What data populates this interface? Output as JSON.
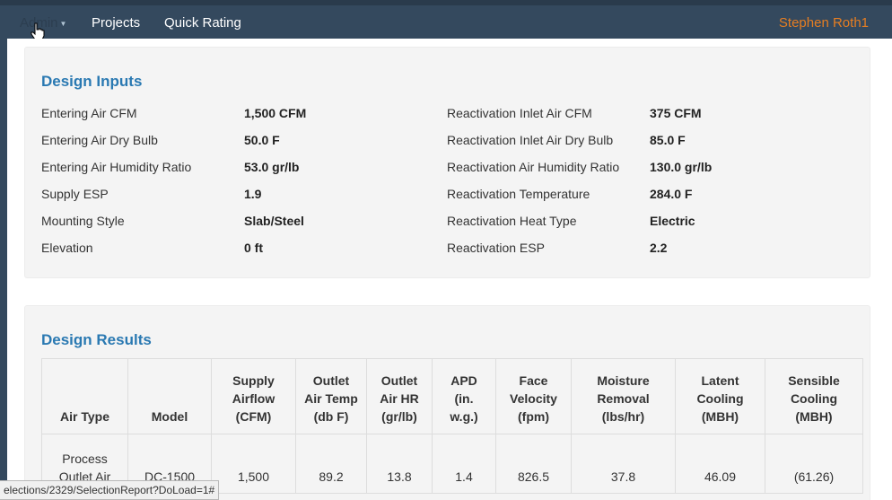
{
  "nav": {
    "admin": "Admin",
    "projects": "Projects",
    "quick_rating": "Quick Rating",
    "user": "Stephen Roth1"
  },
  "design_inputs": {
    "title": "Design Inputs",
    "left": [
      {
        "label": "Entering Air CFM",
        "value": "1,500 CFM"
      },
      {
        "label": "Entering Air Dry Bulb",
        "value": "50.0 F"
      },
      {
        "label": "Entering Air Humidity Ratio",
        "value": "53.0 gr/lb"
      },
      {
        "label": "Supply ESP",
        "value": "1.9"
      },
      {
        "label": "Mounting Style",
        "value": "Slab/Steel"
      },
      {
        "label": "Elevation",
        "value": "0 ft"
      }
    ],
    "right": [
      {
        "label": "Reactivation Inlet Air CFM",
        "value": "375 CFM"
      },
      {
        "label": "Reactivation Inlet Air Dry Bulb",
        "value": "85.0 F"
      },
      {
        "label": "Reactivation Air Humidity Ratio",
        "value": "130.0 gr/lb"
      },
      {
        "label": "Reactivation Temperature",
        "value": "284.0 F"
      },
      {
        "label": "Reactivation Heat Type",
        "value": "Electric"
      },
      {
        "label": "Reactivation ESP",
        "value": "2.2"
      }
    ]
  },
  "design_results": {
    "title": "Design Results",
    "headers": [
      [
        "Air Type"
      ],
      [
        "Model"
      ],
      [
        "Supply",
        "Airflow",
        "(CFM)"
      ],
      [
        "Outlet",
        "Air Temp",
        "(db F)"
      ],
      [
        "Outlet",
        "Air HR",
        "(gr/lb)"
      ],
      [
        "APD",
        "(in.",
        "w.g.)"
      ],
      [
        "Face",
        "Velocity",
        "(fpm)"
      ],
      [
        "Moisture",
        "Removal",
        "(lbs/hr)"
      ],
      [
        "Latent",
        "Cooling",
        "(MBH)"
      ],
      [
        "Sensible",
        "Cooling",
        "(MBH)"
      ]
    ],
    "rows": [
      [
        [
          "Process",
          "Outlet Air"
        ],
        [
          "DC-1500"
        ],
        [
          "1,500"
        ],
        [
          "89.2"
        ],
        [
          "13.8"
        ],
        [
          "1.4"
        ],
        [
          "826.5"
        ],
        [
          "37.8"
        ],
        [
          "46.09"
        ],
        [
          "(61.26)"
        ]
      ]
    ]
  },
  "status_url": "elections/2329/SelectionReport?DoLoad=1#"
}
